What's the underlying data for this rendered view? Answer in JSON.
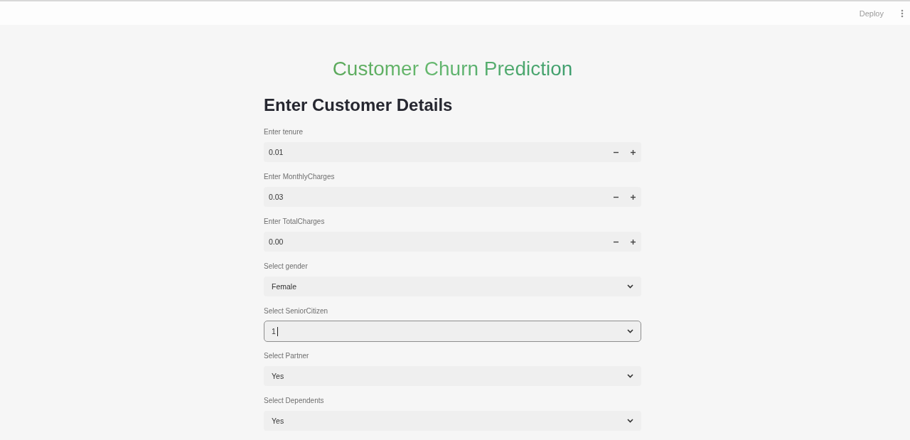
{
  "header": {
    "deploy_button": "Deploy"
  },
  "title": "Customer Churn Prediction",
  "heading": "Enter Customer Details",
  "fields": [
    {
      "kind": "number",
      "label": "Enter tenure",
      "value": "0.01",
      "focused": false
    },
    {
      "kind": "number",
      "label": "Enter MonthlyCharges",
      "value": "0.03",
      "focused": false
    },
    {
      "kind": "number",
      "label": "Enter TotalCharges",
      "value": "0.00",
      "focused": false
    },
    {
      "kind": "select",
      "label": "Select gender",
      "value": "Female",
      "focused": false
    },
    {
      "kind": "select",
      "label": "Select SeniorCitizen",
      "value": "1",
      "focused": true
    },
    {
      "kind": "select",
      "label": "Select Partner",
      "value": "Yes",
      "focused": false
    },
    {
      "kind": "select",
      "label": "Select Dependents",
      "value": "Yes",
      "focused": false
    }
  ]
}
